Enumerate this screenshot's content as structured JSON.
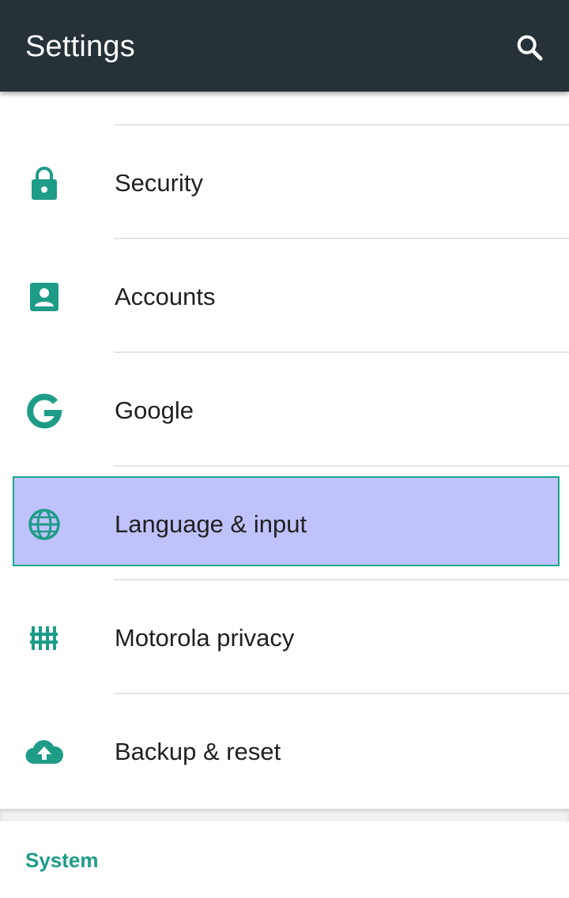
{
  "app_bar": {
    "title": "Settings",
    "search_icon": "search-icon",
    "background": "#263238"
  },
  "items": [
    {
      "label": "Security",
      "icon": "lock-icon"
    },
    {
      "label": "Accounts",
      "icon": "account-box-icon"
    },
    {
      "label": "Google",
      "icon": "google-icon"
    },
    {
      "label": "Language & input",
      "icon": "globe-icon",
      "highlighted": true
    },
    {
      "label": "Motorola privacy",
      "icon": "fence-icon"
    },
    {
      "label": "Backup & reset",
      "icon": "cloud-upload-icon"
    }
  ],
  "sections": {
    "system_header": "System"
  },
  "colors": {
    "accent": "#1e9c88",
    "icon": "#1e9c88",
    "highlight_fill": "#c0c2fb",
    "highlight_border": "#17a78a"
  }
}
